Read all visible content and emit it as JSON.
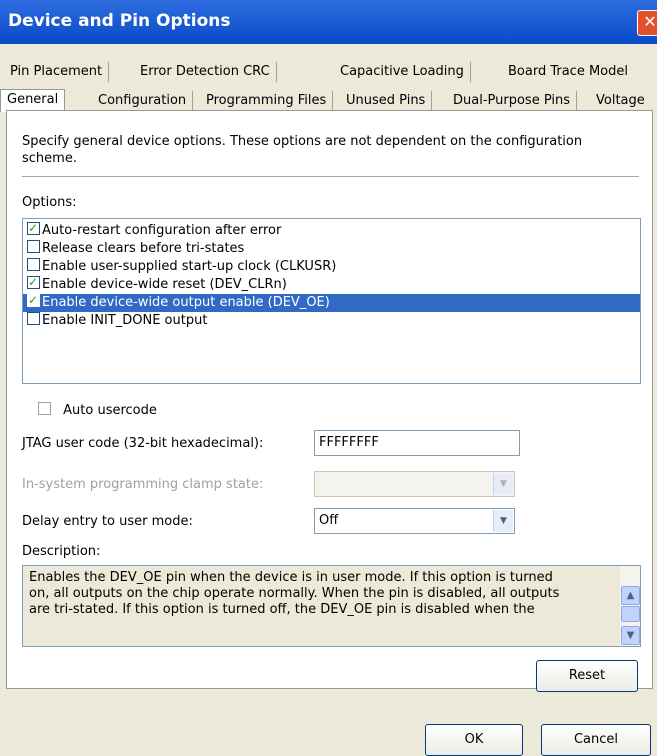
{
  "window": {
    "title": "Device and Pin Options",
    "close_glyph": "✕"
  },
  "tabs_back": [
    "Pin Placement",
    "Error Detection CRC",
    "Capacitive Loading",
    "Board Trace Model"
  ],
  "tabs_front": [
    "General",
    "Configuration",
    "Programming Files",
    "Unused Pins",
    "Dual-Purpose Pins",
    "Voltage"
  ],
  "active_tab": "General",
  "intro_line1": "Specify general device options. These options are not dependent on the configuration",
  "intro_line2": "scheme.",
  "options_label": "Options:",
  "options": [
    {
      "label": "Auto-restart configuration after error",
      "checked": true,
      "selected": false
    },
    {
      "label": "Release clears before tri-states",
      "checked": false,
      "selected": false
    },
    {
      "label": "Enable user-supplied start-up clock (CLKUSR)",
      "checked": false,
      "selected": false
    },
    {
      "label": "Enable device-wide reset (DEV_CLRn)",
      "checked": true,
      "selected": false
    },
    {
      "label": "Enable device-wide output enable (DEV_OE)",
      "checked": true,
      "selected": true
    },
    {
      "label": "Enable INIT_DONE output",
      "checked": false,
      "selected": false
    }
  ],
  "auto_usercode": {
    "label": "Auto usercode",
    "checked": false
  },
  "jtag": {
    "label": "JTAG user code (32-bit hexadecimal):",
    "value": "FFFFFFFF"
  },
  "isp_clamp": {
    "label": "In-system programming clamp state:",
    "value": ""
  },
  "delay_entry": {
    "label": "Delay entry to user mode:",
    "value": "Off"
  },
  "description": {
    "label": "Description:",
    "lines": [
      "Enables the DEV_OE pin when the device is in user mode. If this option is turned",
      "on, all outputs on the chip operate normally. When the pin is disabled, all outputs",
      "are tri-stated. If this option is turned off, the DEV_OE pin is disabled when the"
    ]
  },
  "buttons": {
    "reset": "Reset",
    "ok": "OK",
    "cancel": "Cancel"
  },
  "icons": {
    "dropdown": "▼",
    "scroll_up": "▲",
    "scroll_down": "▼"
  }
}
